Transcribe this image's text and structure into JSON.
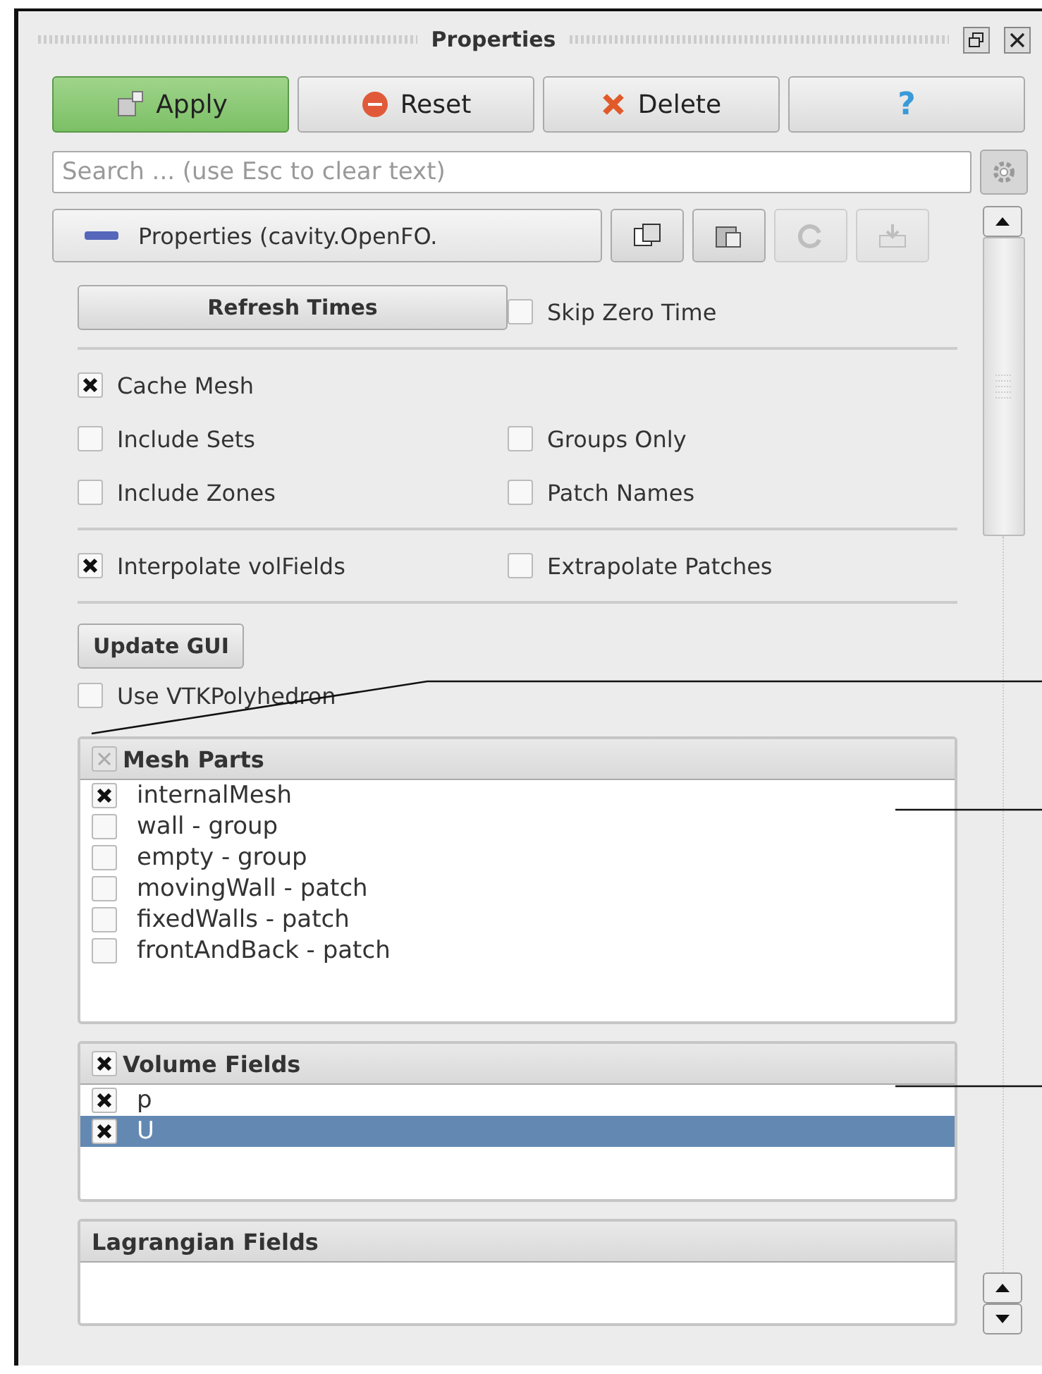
{
  "panel": {
    "title": "Properties"
  },
  "actions": [
    {
      "kind": "apply",
      "label": "Apply"
    },
    {
      "kind": "reset",
      "label": "Reset"
    },
    {
      "kind": "delete",
      "label": "Delete"
    },
    {
      "kind": "help",
      "label": "?"
    }
  ],
  "search": {
    "placeholder": "Search ... (use Esc to clear text)"
  },
  "section": {
    "label": "Properties (cavity.OpenFO.",
    "tools": [
      {
        "kind": "copy",
        "disabled": false
      },
      {
        "kind": "paste",
        "disabled": false
      },
      {
        "kind": "redo",
        "disabled": true
      },
      {
        "kind": "save",
        "disabled": true
      }
    ]
  },
  "refresh_button": "Refresh Times",
  "skip_zero_time": {
    "label": "Skip Zero Time",
    "checked": false
  },
  "options": [
    [
      {
        "label": "Cache Mesh",
        "checked": true
      }
    ],
    [
      {
        "label": "Include Sets",
        "checked": false
      },
      {
        "label": "Groups Only",
        "checked": false
      }
    ],
    [
      {
        "label": "Include Zones",
        "checked": false
      },
      {
        "label": "Patch Names",
        "checked": false
      }
    ]
  ],
  "interp": [
    {
      "label": "Interpolate volFields",
      "checked": true
    },
    {
      "label": "Extrapolate Patches",
      "checked": false
    }
  ],
  "update_button": "Update GUI",
  "use_vtk": {
    "label": "Use VTKPolyhedron",
    "checked": false
  },
  "lists": [
    {
      "title": "Mesh Parts",
      "header_checkbox": {
        "checked": false,
        "partial": true
      },
      "rows": [
        {
          "label": "internalMesh",
          "checked": true,
          "selected": false
        },
        {
          "label": "wall - group",
          "checked": false,
          "selected": false
        },
        {
          "label": "empty - group",
          "checked": false,
          "selected": false
        },
        {
          "label": "movingWall - patch",
          "checked": false,
          "selected": false
        },
        {
          "label": "fixedWalls - patch",
          "checked": false,
          "selected": false
        },
        {
          "label": "frontAndBack - patch",
          "checked": false,
          "selected": false
        }
      ]
    },
    {
      "title": "Volume Fields",
      "header_checkbox": {
        "checked": true,
        "partial": false
      },
      "rows": [
        {
          "label": "p",
          "checked": true,
          "selected": false
        },
        {
          "label": "U",
          "checked": true,
          "selected": true
        }
      ]
    },
    {
      "title": "Lagrangian Fields"
    }
  ]
}
